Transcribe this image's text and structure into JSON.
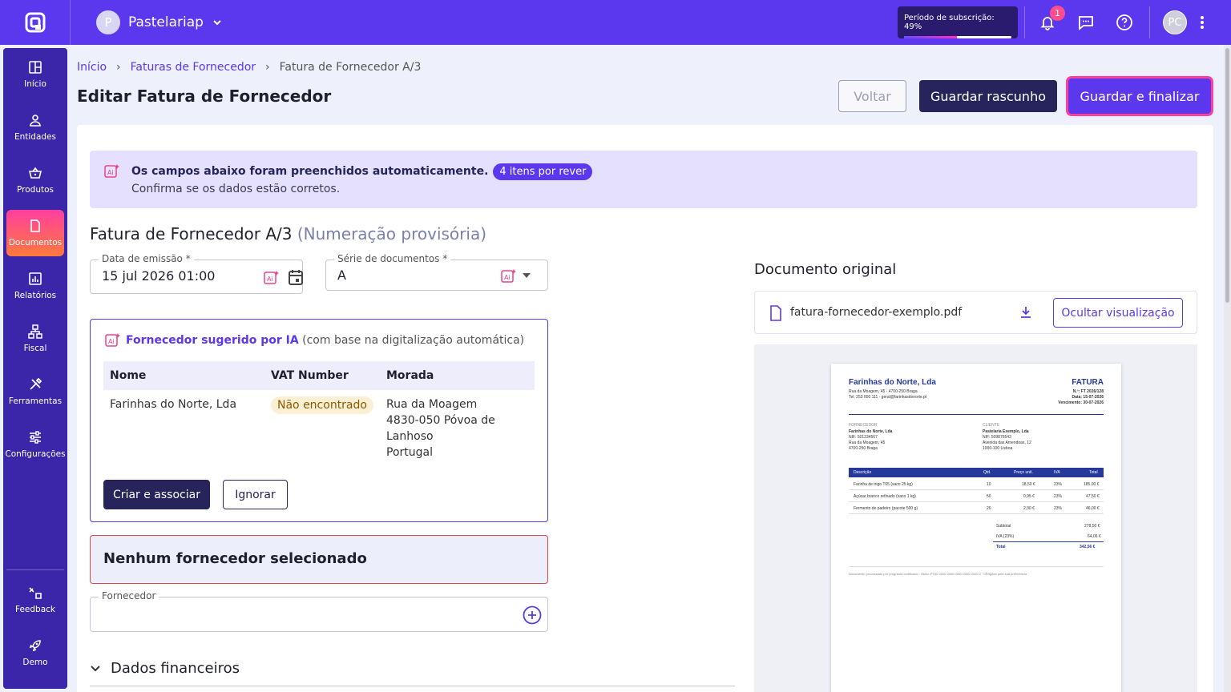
{
  "topbar": {
    "company_initial": "P",
    "company": "Pastelariap",
    "subscription_label": "Período de subscrição: 49%",
    "subscription_pct": 49,
    "notifications": "1",
    "user_initials": "PC"
  },
  "sidebar": {
    "items": [
      {
        "label": "Início",
        "icon": "grid-icon"
      },
      {
        "label": "Entidades",
        "icon": "person-icon"
      },
      {
        "label": "Produtos",
        "icon": "basket-icon"
      },
      {
        "label": "Documentos",
        "icon": "document-icon"
      },
      {
        "label": "Relatórios",
        "icon": "report-icon"
      },
      {
        "label": "Fiscal",
        "icon": "fiscal-icon"
      },
      {
        "label": "Ferramentas",
        "icon": "tools-icon"
      },
      {
        "label": "Configurações",
        "icon": "sliders-icon"
      },
      {
        "label": "Feedback",
        "icon": "feedback-icon"
      },
      {
        "label": "Demo",
        "icon": "rocket-icon"
      }
    ]
  },
  "breadcrumb": {
    "home": "Início",
    "section": "Faturas de Fornecedor",
    "current": "Fatura de Fornecedor A/3"
  },
  "page": {
    "title": "Editar Fatura de Fornecedor",
    "back": "Voltar",
    "save_draft": "Guardar rascunho",
    "save_final": "Guardar e finalizar"
  },
  "banner": {
    "text": "Os campos abaixo foram preenchidos automaticamente.",
    "pill": "4 itens por rever",
    "sub": "Confirma se os dados estão corretos."
  },
  "invoice": {
    "title": "Fatura de Fornecedor A/3",
    "provisional": "(Numeração provisória)",
    "date_label": "Data de emissão *",
    "date_value": "15 jul 2026 01:00",
    "series_label": "Série de documentos *",
    "series_value": "A"
  },
  "suggest": {
    "title": "Fornecedor sugerido por IA",
    "note": "(com base na digitalização automática)",
    "col_name": "Nome",
    "col_vat": "VAT Number",
    "col_addr": "Morada",
    "name": "Farinhas do Norte, Lda",
    "vat": "Não encontrado",
    "addr1": "Rua da Moagem",
    "addr2": "4830-050 Póvoa de",
    "addr3": "Lanhoso",
    "addr4": "Portugal",
    "create": "Criar e associar",
    "ignore": "Ignorar"
  },
  "no_supplier": "Nenhum fornecedor selecionado",
  "supplier_label": "Fornecedor",
  "financial": "Dados financeiros",
  "original": {
    "title": "Documento original",
    "file": "fatura-fornecedor-exemplo.pdf",
    "hide": "Ocultar visualização"
  },
  "pdf": {
    "company": "Farinhas do Norte, Lda",
    "addr": "Rua da Moagem, 45 · 4700-250 Braga",
    "contact": "Tel: 253 000 111 · geral@farinhasdonorte.pt",
    "doc": "FATURA",
    "no": "N.º: FT 2026/128",
    "date": "Data: 15-07-2026",
    "due": "Vencimento: 30-07-2026",
    "supplier_h": "FORNECEDOR",
    "supplier": [
      "Farinhas do Norte, Lda",
      "NIF: 501234567",
      "Rua da Moagem, 45",
      "4700-250 Braga"
    ],
    "client_h": "CLIENTE",
    "client": [
      "Pastelaria Exemplo, Lda",
      "NIF: 509876543",
      "Avenida das Amendoas, 12",
      "1000-100 Lisboa"
    ],
    "cols": [
      "Descrição",
      "Qtd.",
      "Preço unit.",
      "IVA",
      "Total"
    ],
    "rows": [
      [
        "Farinha de trigo T65 (saco 25 kg)",
        "10",
        "18,50 €",
        "23%",
        "185,00 €"
      ],
      [
        "Açúcar branco refinado (saco 1 kg)",
        "50",
        "0,95 €",
        "23%",
        "47,50 €"
      ],
      [
        "Fermento de padeiro (pacote 500 g)",
        "20",
        "2,30 €",
        "23%",
        "46,00 €"
      ]
    ],
    "subtotal_l": "Subtotal",
    "subtotal": "278,50 €",
    "vat_l": "IVA (23%)",
    "vat": "64,06 €",
    "total_l": "Total",
    "total": "342,56 €",
    "footer": "Documento processado por programa certificado · IBAN: PT50 0000 0000 0000 0000 0000 0 · Obrigado pela sua preferência"
  }
}
